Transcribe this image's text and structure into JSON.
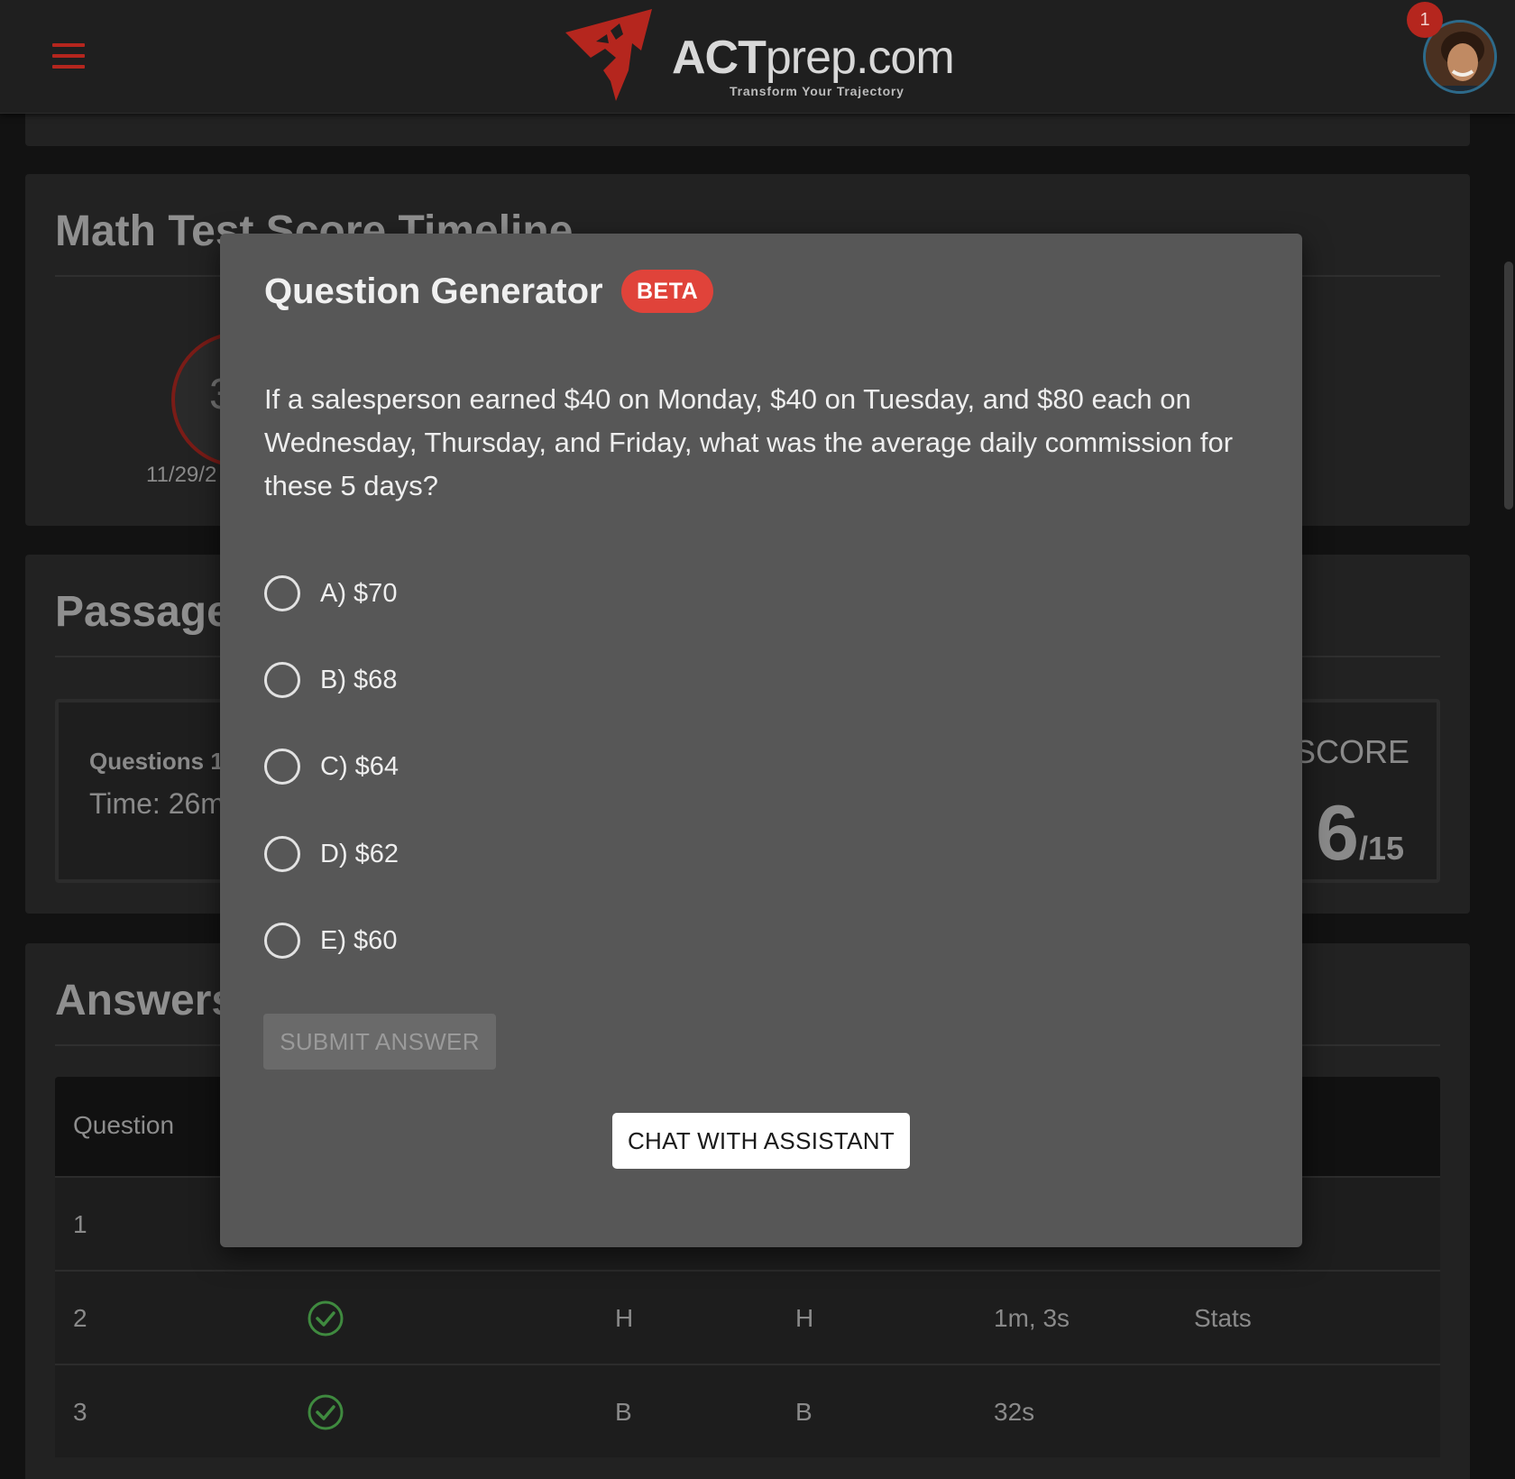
{
  "header": {
    "brand_bold": "ACT",
    "brand_rest": "prep.com",
    "tagline": "Transform Your Trajectory",
    "notification_count": "1",
    "menu_icon": "hamburger-menu-icon",
    "accent_color": "#b5261e"
  },
  "page": {
    "timeline_card": {
      "title": "Math Test Score Timeline",
      "score_circle_value": "3",
      "date_label": "11/29/2"
    },
    "passage_card": {
      "title": "Passage",
      "questions_label": "Questions 1",
      "time_label": "Time: 26m",
      "score_label": "SCORE",
      "score_value": "6",
      "score_total": "/15"
    },
    "answers_card": {
      "title": "Answers",
      "column_header": "Question",
      "rows": [
        {
          "num": "1",
          "correct": null,
          "answer": "",
          "key": "",
          "time": "",
          "stats": ""
        },
        {
          "num": "2",
          "correct": true,
          "answer": "H",
          "key": "H",
          "time": "1m, 3s",
          "stats": "Stats"
        },
        {
          "num": "3",
          "correct": true,
          "answer": "B",
          "key": "B",
          "time": "32s",
          "stats": ""
        }
      ]
    }
  },
  "modal": {
    "title": "Question Generator",
    "badge": "BETA",
    "badge_color": "#e0433a",
    "question": "If a salesperson earned $40 on Monday, $40 on Tuesday, and $80 each on Wednesday, Thursday, and Friday, what was the average daily commission for these 5 days?",
    "options": [
      {
        "label": "A) $70"
      },
      {
        "label": "B) $68"
      },
      {
        "label": "C) $64"
      },
      {
        "label": "D) $62"
      },
      {
        "label": "E) $60"
      }
    ],
    "submit_label": "SUBMIT ANSWER",
    "chat_label": "CHAT WITH ASSISTANT"
  }
}
